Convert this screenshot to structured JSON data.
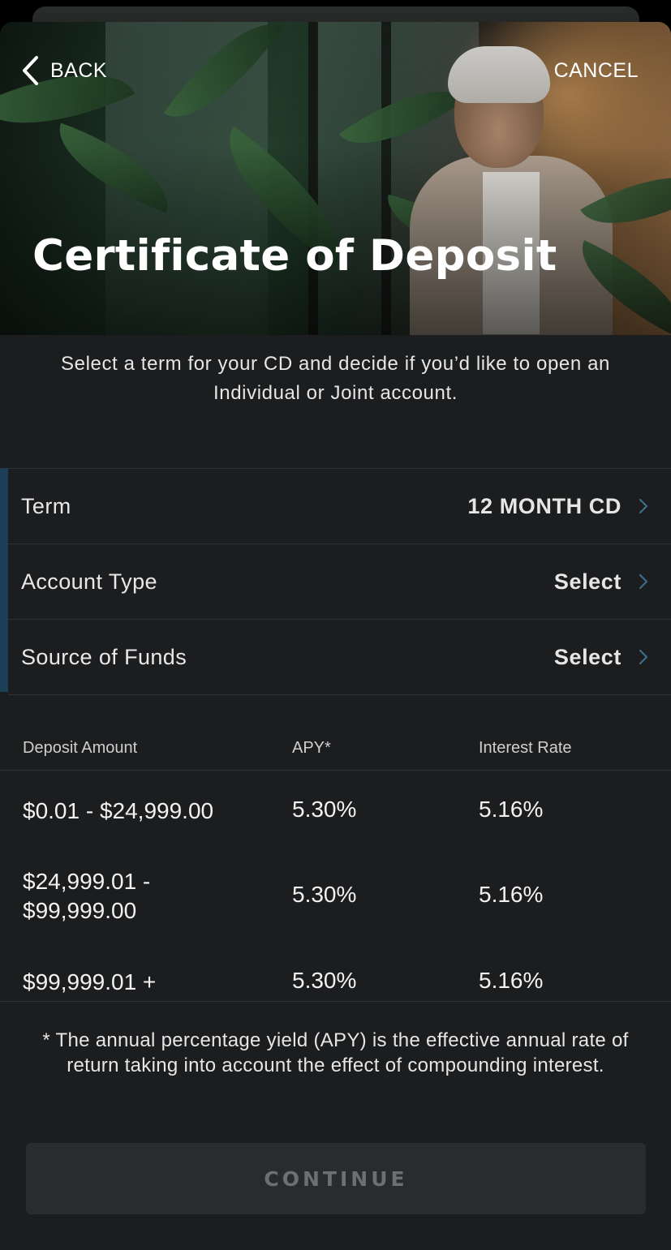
{
  "nav": {
    "back_label": "BACK",
    "cancel_label": "CANCEL"
  },
  "hero": {
    "title": "Certificate of Deposit"
  },
  "intro": "Select a term for your CD and decide if you’d like to open an Individual or Joint account.",
  "options": [
    {
      "label": "Term",
      "value": "12 MONTH CD"
    },
    {
      "label": "Account Type",
      "value": "Select"
    },
    {
      "label": "Source of Funds",
      "value": "Select"
    }
  ],
  "rates_table": {
    "headers": [
      "Deposit Amount",
      "APY*",
      "Interest Rate"
    ],
    "rows": [
      {
        "deposit": "$0.01 - $24,999.00",
        "apy": "5.30%",
        "rate": "5.16%"
      },
      {
        "deposit_line1": "$24,999.01 -",
        "deposit_line2": "$99,999.00",
        "apy": "5.30%",
        "rate": "5.16%"
      },
      {
        "deposit": "$99,999.01 +",
        "apy": "5.30%",
        "rate": "5.16%"
      }
    ]
  },
  "footnote": "* The annual percentage yield (APY) is the effective annual rate of return taking into account the effect of compounding interest.",
  "continue_label": "CONTINUE",
  "colors": {
    "background": "#1c1d1f",
    "accent_bar": "#1d3e57",
    "chevron": "#3b6d8f",
    "button_bg": "#2a2b2f",
    "button_text_disabled": "#6e6f73"
  },
  "icons": {
    "back": "chevron-left-icon",
    "row_disclosure": "chevron-right-icon"
  }
}
